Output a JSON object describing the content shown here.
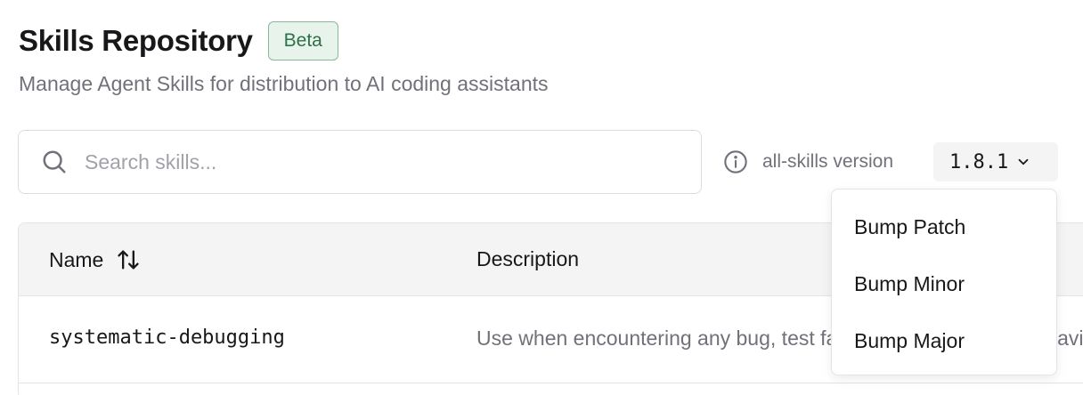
{
  "header": {
    "title": "Skills Repository",
    "badge": "Beta",
    "subtitle": "Manage Agent Skills for distribution to AI coding assistants"
  },
  "search": {
    "placeholder": "Search skills...",
    "value": ""
  },
  "version": {
    "label": "all-skills version",
    "current": "1.8.1"
  },
  "table": {
    "columns": [
      "Name",
      "Description"
    ],
    "rows": [
      {
        "name": "systematic-debugging",
        "description": "Use when encountering any bug, test failure, or unexpected behavior"
      }
    ]
  },
  "version_menu": {
    "items": [
      "Bump Patch",
      "Bump Minor",
      "Bump Major"
    ]
  },
  "colors": {
    "badge_bg": "#e8f3ec",
    "badge_border": "#86b99a",
    "badge_text": "#2e7048",
    "muted_text": "#71717a",
    "header_bg": "#f4f4f5"
  },
  "icons": [
    "search-icon",
    "info-icon",
    "chevron-down-icon",
    "sort-icon"
  ]
}
